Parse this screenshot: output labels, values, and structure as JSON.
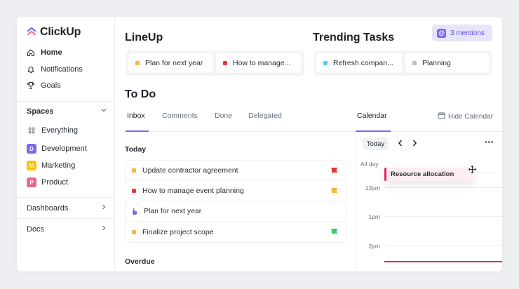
{
  "app": {
    "name": "ClickUp"
  },
  "sidebar": {
    "nav": [
      {
        "label": "Home",
        "icon": "home-icon"
      },
      {
        "label": "Notifications",
        "icon": "bell-icon"
      },
      {
        "label": "Goals",
        "icon": "trophy-icon"
      }
    ],
    "spaces_label": "Spaces",
    "everything_label": "Everything",
    "spaces": [
      {
        "badge": "D",
        "label": "Development",
        "color": "#7b68ee"
      },
      {
        "badge": "M",
        "label": "Marketing",
        "color": "#ffc107"
      },
      {
        "badge": "P",
        "label": "Product",
        "color": "#f06292"
      }
    ],
    "dashboards_label": "Dashboards",
    "docs_label": "Docs"
  },
  "lineup": {
    "title": "LineUp",
    "items": [
      {
        "label": "Plan for next year",
        "color": "#f6b73c"
      },
      {
        "label": "How to manage...",
        "color": "#e53935"
      }
    ]
  },
  "trending": {
    "title": "Trending Tasks",
    "items": [
      {
        "label": "Refresh compan...",
        "color": "#49ccf9"
      },
      {
        "label": "Planning",
        "color": "#b9bec7"
      }
    ]
  },
  "mentions": {
    "label": "3 mentions"
  },
  "todo": {
    "title": "To Do",
    "tabs": [
      "Inbox",
      "Comments",
      "Done",
      "Delegated"
    ],
    "today_label": "Today",
    "overdue_label": "Overdue",
    "tasks": [
      {
        "label": "Update contractor agreement",
        "status_color": "#f6b73c",
        "flag_color": "#e53935"
      },
      {
        "label": "How to manage event planning",
        "status_color": "#e53935",
        "flag_color": "#f6b73c"
      },
      {
        "label": "Plan for next year",
        "status_color": "#7b68ee",
        "flag_color": ""
      },
      {
        "label": "Finalize project scope",
        "status_color": "#f6b73c",
        "flag_color": "#2ecd6f"
      }
    ]
  },
  "calendar": {
    "tab_label": "Calendar",
    "hide_label": "Hide Calendar",
    "today_button": "Today",
    "all_day_label": "All day",
    "times": [
      "12pm",
      "1pm",
      "2pm"
    ],
    "event": {
      "label": "Resource allocation",
      "color": "#e2245f"
    }
  }
}
